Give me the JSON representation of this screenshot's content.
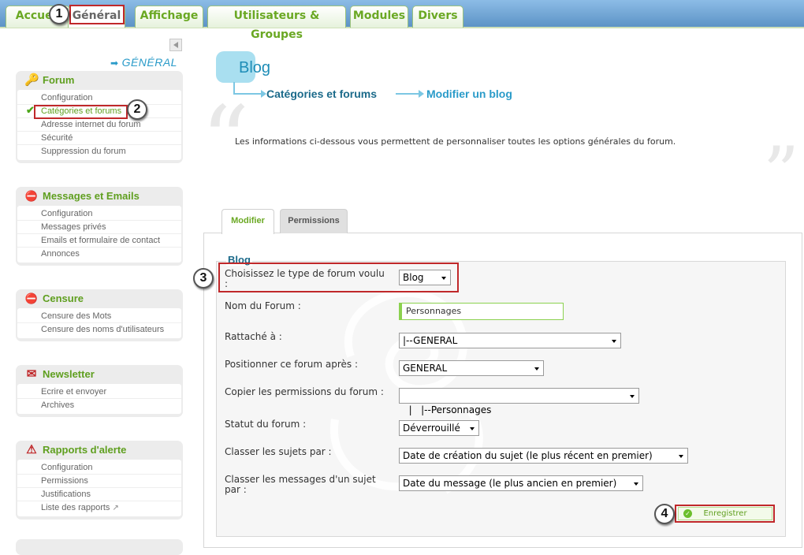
{
  "top_tabs": [
    {
      "label": "Accueil",
      "active": false
    },
    {
      "label": "Général",
      "active": true
    },
    {
      "label": "Affichage",
      "active": false
    },
    {
      "label": "Utilisateurs & Groupes",
      "active": false
    },
    {
      "label": "Modules",
      "active": false
    },
    {
      "label": "Divers",
      "active": false
    }
  ],
  "sidebar": {
    "section_title": "GÉNÉRAL",
    "menus": [
      {
        "title": "Forum",
        "icon": "key-icon",
        "items": [
          "Configuration",
          "Catégories et forums",
          "Adresse internet du forum",
          "Sécurité",
          "Suppression du forum"
        ],
        "selected_index": 1
      },
      {
        "title": "Messages et Emails",
        "icon": "mail-document-icon",
        "items": [
          "Configuration",
          "Messages privés",
          "Emails et formulaire de contact",
          "Annonces"
        ]
      },
      {
        "title": "Censure",
        "icon": "censor-icon",
        "items": [
          "Censure des Mots",
          "Censure des noms d'utilisateurs"
        ]
      },
      {
        "title": "Newsletter",
        "icon": "newsletter-icon",
        "items": [
          "Ecrire et envoyer",
          "Archives"
        ]
      },
      {
        "title": "Rapports d'alerte",
        "icon": "alert-report-icon",
        "items": [
          "Configuration",
          "Permissions",
          "Justifications",
          "Liste des rapports"
        ]
      }
    ]
  },
  "page": {
    "title": "Blog",
    "breadcrumb": [
      "Catégories et forums",
      "Modifier un blog"
    ],
    "intro": "Les informations ci-dessous vous permettent de personnaliser toutes les options générales du forum."
  },
  "content_tabs": [
    "Modifier",
    "Permissions"
  ],
  "form": {
    "title": "Blog",
    "fields": {
      "type_label": "Choisissez le type de forum voulu :",
      "type_value": "Blog",
      "name_label": "Nom du Forum :",
      "name_value": "Personnages",
      "attached_label": "Rattaché à :",
      "attached_value": "|--GENERAL",
      "position_label": "Positionner ce forum après :",
      "position_value": "GENERAL",
      "copy_perms_label": "Copier les permissions du forum :",
      "copy_perms_value": "|   |--Personnages",
      "status_label": "Statut du forum :",
      "status_value": "Déverrouillé",
      "sort_topics_label": "Classer les sujets par :",
      "sort_topics_value": "Date de création du sujet (le plus récent en premier)",
      "sort_msgs_label": "Classer les messages d'un sujet par :",
      "sort_msgs_value": "Date du message (le plus ancien en premier)"
    },
    "save_label": "Enregistrer"
  },
  "annotations": [
    "1",
    "2",
    "3",
    "4"
  ],
  "colors": {
    "accent_green": "#6aa823",
    "accent_blue": "#1e8db7",
    "annotation_red": "#c0282a"
  }
}
